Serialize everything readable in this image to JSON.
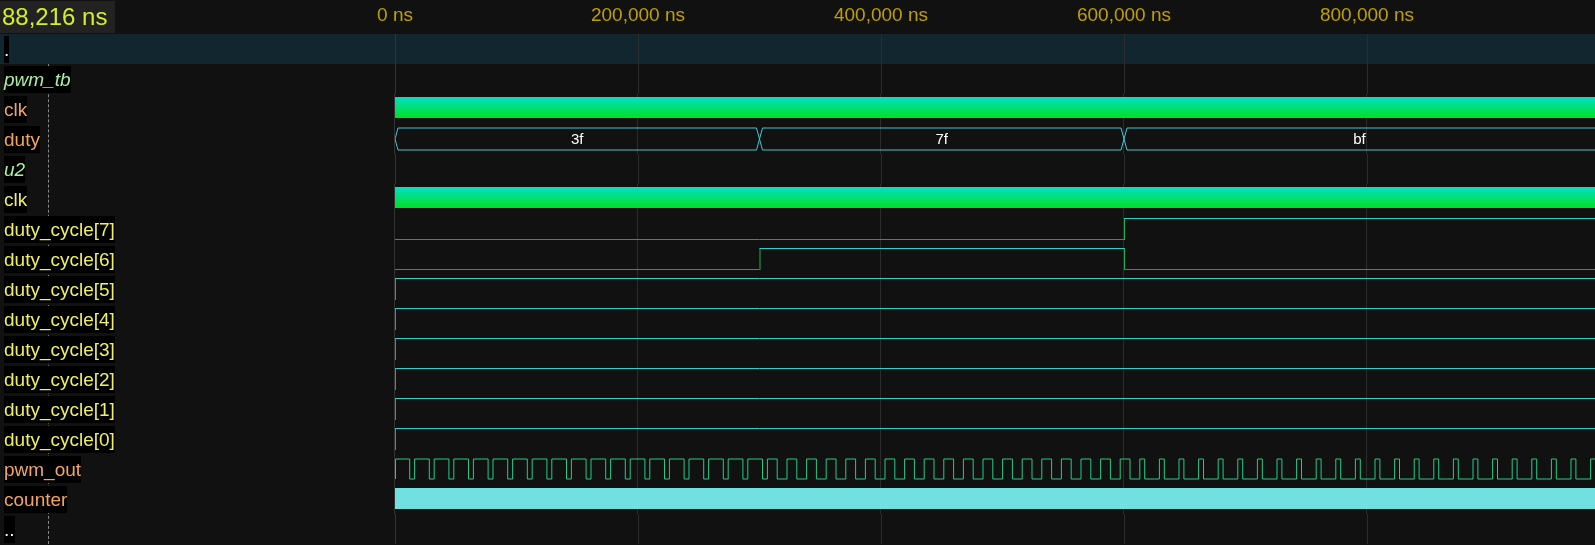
{
  "cursor": {
    "readout": "88,216 ns"
  },
  "timeline": {
    "ticks": [
      "0 ns",
      "200,000 ns",
      "400,000 ns",
      "600,000 ns",
      "800,000 ns"
    ]
  },
  "rows": [
    {
      "kind": "marker",
      "name": ".",
      "selected": true
    },
    {
      "kind": "scope",
      "name": "pwm_tb",
      "color": "#a8f0a0",
      "selected": false
    },
    {
      "kind": "clock",
      "name": "clk",
      "color": "#f4a460",
      "selected": false
    },
    {
      "kind": "bus",
      "name": "duty",
      "color": "#f4a460",
      "selected": false,
      "segments": [
        {
          "value": "3f"
        },
        {
          "value": "7f"
        },
        {
          "value": "bf"
        }
      ]
    },
    {
      "kind": "scope",
      "name": "u2",
      "color": "#a8f0a0",
      "selected": false
    },
    {
      "kind": "clock",
      "name": "clk",
      "color": "#f0f060",
      "selected": false
    },
    {
      "kind": "bit",
      "name": "duty_cycle[7]",
      "color": "#f0f060",
      "selected": false,
      "segments": [
        {
          "high": false
        },
        {
          "high": false
        },
        {
          "high": true
        }
      ]
    },
    {
      "kind": "bit",
      "name": "duty_cycle[6]",
      "color": "#f0f060",
      "selected": false,
      "segments": [
        {
          "high": false
        },
        {
          "high": true
        },
        {
          "high": false
        }
      ]
    },
    {
      "kind": "bit",
      "name": "duty_cycle[5]",
      "color": "#f0f060",
      "selected": false,
      "segments": [
        {
          "high": true
        },
        {
          "high": true
        },
        {
          "high": true
        }
      ]
    },
    {
      "kind": "bit",
      "name": "duty_cycle[4]",
      "color": "#f0f060",
      "selected": false,
      "segments": [
        {
          "high": true
        },
        {
          "high": true
        },
        {
          "high": true
        }
      ]
    },
    {
      "kind": "bit",
      "name": "duty_cycle[3]",
      "color": "#f0f060",
      "selected": false,
      "segments": [
        {
          "high": true
        },
        {
          "high": true
        },
        {
          "high": true
        }
      ]
    },
    {
      "kind": "bit",
      "name": "duty_cycle[2]",
      "color": "#f0f060",
      "selected": false,
      "segments": [
        {
          "high": true
        },
        {
          "high": true
        },
        {
          "high": true
        }
      ]
    },
    {
      "kind": "bit",
      "name": "duty_cycle[1]",
      "color": "#f0f060",
      "selected": false,
      "segments": [
        {
          "high": true
        },
        {
          "high": true
        },
        {
          "high": true
        }
      ]
    },
    {
      "kind": "bit",
      "name": "duty_cycle[0]",
      "color": "#f0f060",
      "selected": false,
      "segments": [
        {
          "high": true
        },
        {
          "high": true
        },
        {
          "high": true
        }
      ]
    },
    {
      "kind": "pwm",
      "name": "pwm_out",
      "color": "#f4a460",
      "selected": false
    },
    {
      "kind": "counter",
      "name": "counter",
      "color": "#f4a460",
      "selected": false
    },
    {
      "kind": "marker",
      "name": "..",
      "selected": false
    }
  ]
}
